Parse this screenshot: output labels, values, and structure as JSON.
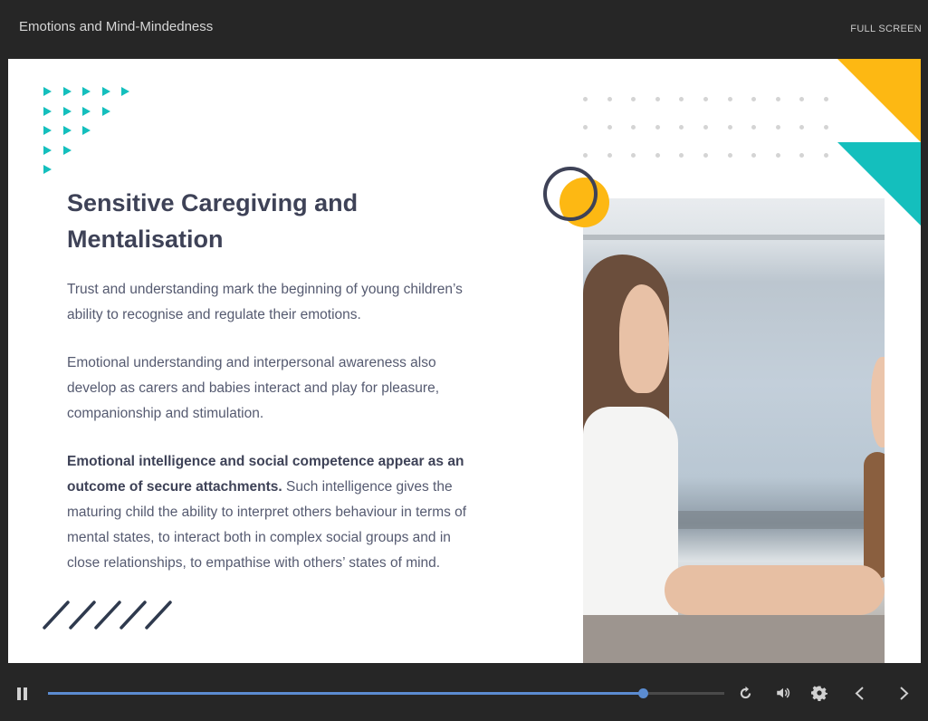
{
  "header": {
    "course_title": "Emotions and Mind-Mindedness",
    "fullscreen_label": "FULL SCREEN"
  },
  "slide": {
    "title_line1": "Sensitive Caregiving and",
    "title_line2": "Mentalisation",
    "paragraph1": "Trust and understanding mark the beginning of young children’s ability to recognise and regulate their emotions.",
    "paragraph2": "Emotional understanding and interpersonal awareness also develop as carers and babies interact and play for pleasure, companionship and stimulation.",
    "paragraph3_bold": "Emotional intelligence and social competence appear as an outcome of secure attachments.",
    "paragraph3_rest": " Such intelligence gives the maturing child the ability to interpret others behaviour in terms of mental states, to interact both in complex social groups and in close relationships, to empathise with others’ states of mind.",
    "image_icon": "photo-two-people-holding-hands"
  },
  "colors": {
    "accent_teal": "#14bfbd",
    "accent_yellow": "#fdb813",
    "title_navy": "#3e4257",
    "progress_blue": "#5b8cd1"
  },
  "player": {
    "progress_fraction": 0.88,
    "icons": [
      "pause-icon",
      "replay-icon",
      "volume-icon",
      "settings-icon",
      "chevron-left-icon",
      "chevron-right-icon"
    ]
  }
}
